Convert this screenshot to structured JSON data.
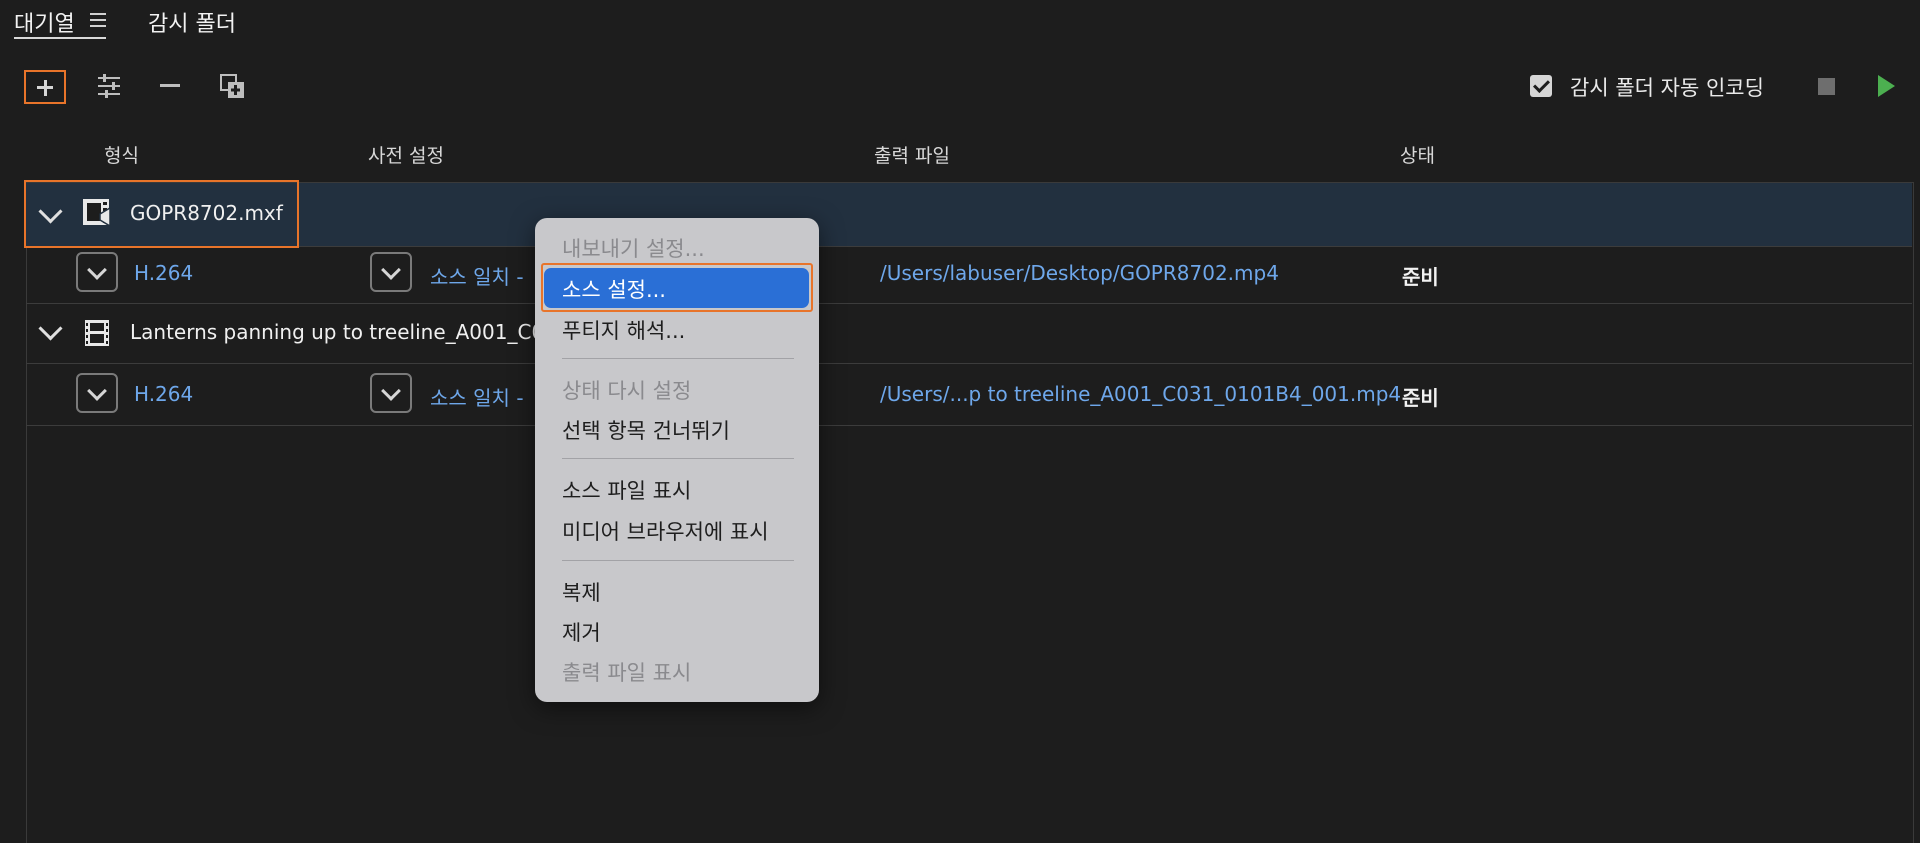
{
  "tabs": {
    "queue": "대기열",
    "watch_folder": "감시 폴더"
  },
  "toolbar": {
    "auto_encode_label": "감시 폴더 자동 인코딩",
    "auto_encode_checked": true
  },
  "columns": {
    "format": "형식",
    "preset": "사전 설정",
    "output_file": "출력 파일",
    "status": "상태"
  },
  "queue": [
    {
      "source": "GOPR8702.mxf",
      "format": "H.264",
      "preset": "소스 일치 - ",
      "output": "/Users/labuser/Desktop/GOPR8702.mp4",
      "status": "준비"
    },
    {
      "source": "Lanterns panning up to treeline_A001_C031",
      "format": "H.264",
      "preset": "소스 일치 - ",
      "output": "/Users/...p to treeline_A001_C031_0101B4_001.mp4",
      "status": "준비"
    }
  ],
  "context_menu": {
    "export_settings": "내보내기 설정...",
    "source_settings": "소스 설정...",
    "interpret_footage": "푸티지 해석...",
    "reset_status": "상태 다시 설정",
    "skip_selection": "선택 항목 건너뛰기",
    "reveal_source": "소스 파일 표시",
    "reveal_in_media_browser": "미디어 브라우저에 표시",
    "duplicate": "복제",
    "remove": "제거",
    "reveal_output": "출력 파일 표시"
  },
  "colors": {
    "accent_outline": "#e8742a",
    "menu_highlight": "#2a6fd6",
    "link": "#6ea7ea",
    "play": "#4caf50"
  }
}
